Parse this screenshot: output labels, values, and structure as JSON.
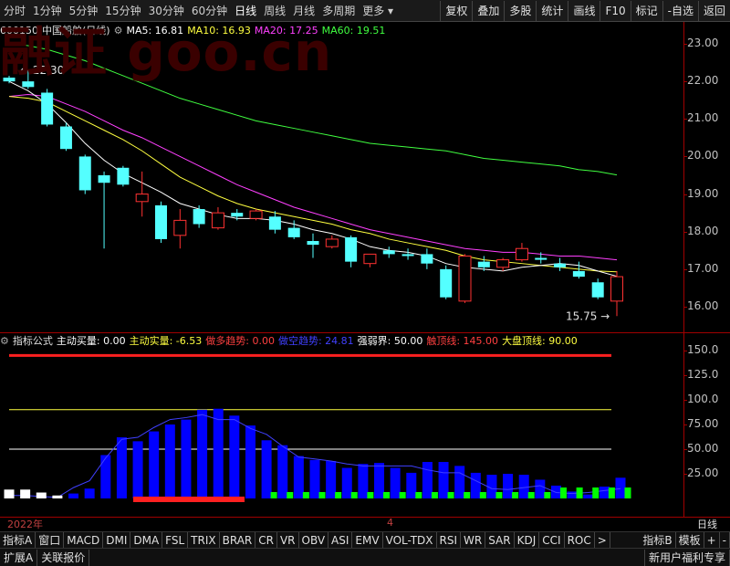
{
  "period_tabs": [
    "分时",
    "1分钟",
    "5分钟",
    "15分钟",
    "30分钟",
    "60分钟",
    "日线",
    "周线",
    "月线",
    "多周期",
    "更多"
  ],
  "active_period": "日线",
  "toolbar": [
    "复权",
    "叠加",
    "多股",
    "统计",
    "画线",
    "F10",
    "标记",
    "-自选",
    "返回"
  ],
  "watermark": "融证 goo.cn",
  "stock": {
    "code": "600150",
    "name": "中国船舶",
    "period": "(日线)"
  },
  "ma": [
    {
      "label": "MA5: 16.81",
      "color": "#ffffff"
    },
    {
      "label": "MA10: 16.93",
      "color": "#ffff40"
    },
    {
      "label": "MA20: 17.25",
      "color": "#ff40ff"
    },
    {
      "label": "MA60: 19.51",
      "color": "#40ff40"
    }
  ],
  "price_ticks": [
    "23.00",
    "22.00",
    "21.00",
    "20.00",
    "19.00",
    "18.00",
    "17.00",
    "16.00"
  ],
  "high_label": "22.30",
  "low_label": "15.75",
  "indicator_name": "指标公式",
  "indicator_values": [
    {
      "label": "主动买量: 0.00",
      "color": "#ffffff"
    },
    {
      "label": "主动实量: -6.53",
      "color": "#ffff40"
    },
    {
      "label": "做多趋势: 0.00",
      "color": "#ff4040"
    },
    {
      "label": "做空趋势: 24.81",
      "color": "#4040ff"
    },
    {
      "label": "强弱界: 50.00",
      "color": "#ffffff"
    },
    {
      "label": "触顶线: 145.00",
      "color": "#ff4040"
    },
    {
      "label": "大盘顶线: 90.00",
      "color": "#ffff40"
    }
  ],
  "ind_ticks": [
    "150.0",
    "125.0",
    "100.0",
    "75.00",
    "50.00",
    "25.00"
  ],
  "time_labels": [
    "2022年",
    "4"
  ],
  "current_period": "日线",
  "indicator_tabs": [
    "指标A",
    "窗口",
    "MACD",
    "DMI",
    "DMA",
    "FSL",
    "TRIX",
    "BRAR",
    "CR",
    "VR",
    "OBV",
    "ASI",
    "EMV",
    "VOL-TDX",
    "RSI",
    "WR",
    "SAR",
    "KDJ",
    "CCI",
    "ROC",
    ">",
    "指标B",
    "模板",
    "+",
    "-"
  ],
  "bottom_buttons": [
    "扩展A",
    "关联报价"
  ],
  "bottom_right": "新用户福利专享",
  "colors": {
    "up": "#ff3232",
    "down": "#54ffff",
    "axis": "#a00000"
  },
  "chart_data": [
    {
      "type": "candlestick",
      "title": "600150 中国船舶 (日线)",
      "ylim": [
        15.6,
        23.3
      ],
      "ohlc": [
        [
          22.1,
          22.15,
          21.95,
          22.0
        ],
        [
          22.0,
          22.3,
          21.8,
          21.85
        ],
        [
          21.7,
          21.8,
          20.8,
          20.85
        ],
        [
          20.8,
          20.9,
          20.15,
          20.2
        ],
        [
          20.0,
          20.05,
          19.0,
          19.1
        ],
        [
          19.5,
          19.6,
          17.55,
          19.3
        ],
        [
          19.7,
          19.75,
          19.2,
          19.25
        ],
        [
          18.8,
          19.6,
          18.4,
          19.0
        ],
        [
          18.7,
          18.8,
          17.7,
          17.8
        ],
        [
          17.9,
          18.6,
          17.55,
          18.3
        ],
        [
          18.6,
          18.7,
          18.1,
          18.2
        ],
        [
          18.1,
          18.65,
          18.05,
          18.5
        ],
        [
          18.5,
          18.6,
          18.3,
          18.4
        ],
        [
          18.35,
          18.6,
          18.3,
          18.55
        ],
        [
          18.4,
          18.55,
          17.95,
          18.05
        ],
        [
          18.1,
          18.3,
          17.8,
          17.85
        ],
        [
          17.75,
          17.95,
          17.3,
          17.65
        ],
        [
          17.6,
          17.9,
          17.55,
          17.8
        ],
        [
          17.85,
          17.9,
          17.05,
          17.2
        ],
        [
          17.15,
          17.4,
          17.05,
          17.4
        ],
        [
          17.5,
          17.6,
          17.3,
          17.4
        ],
        [
          17.4,
          17.55,
          17.25,
          17.35
        ],
        [
          17.4,
          17.55,
          17.0,
          17.15
        ],
        [
          17.0,
          17.1,
          16.2,
          16.25
        ],
        [
          16.15,
          17.4,
          16.1,
          17.35
        ],
        [
          17.2,
          17.35,
          16.95,
          17.05
        ],
        [
          17.05,
          17.3,
          16.95,
          17.25
        ],
        [
          17.25,
          17.7,
          17.2,
          17.55
        ],
        [
          17.3,
          17.45,
          17.15,
          17.25
        ],
        [
          17.15,
          17.3,
          16.95,
          17.05
        ],
        [
          16.95,
          17.2,
          16.75,
          16.8
        ],
        [
          16.65,
          16.75,
          16.2,
          16.25
        ],
        [
          16.15,
          16.95,
          15.75,
          16.8
        ]
      ],
      "ma5": [
        22.0,
        21.75,
        21.4,
        20.9,
        20.35,
        19.9,
        19.55,
        19.3,
        19.05,
        18.75,
        18.6,
        18.45,
        18.35,
        18.35,
        18.3,
        18.2,
        18.05,
        17.95,
        17.8,
        17.6,
        17.5,
        17.45,
        17.35,
        17.15,
        17.05,
        17.0,
        16.95,
        17.05,
        17.1,
        17.15,
        17.1,
        16.95,
        16.81
      ],
      "ma10": [
        21.6,
        21.55,
        21.45,
        21.2,
        20.95,
        20.7,
        20.45,
        20.15,
        19.8,
        19.45,
        19.2,
        18.95,
        18.75,
        18.6,
        18.5,
        18.4,
        18.3,
        18.2,
        18.05,
        17.95,
        17.8,
        17.7,
        17.6,
        17.5,
        17.35,
        17.25,
        17.2,
        17.15,
        17.1,
        17.05,
        17.0,
        16.95,
        16.93
      ],
      "ma20": [
        21.6,
        21.65,
        21.6,
        21.4,
        21.2,
        20.95,
        20.7,
        20.5,
        20.25,
        20.0,
        19.75,
        19.5,
        19.25,
        19.05,
        18.85,
        18.65,
        18.5,
        18.35,
        18.2,
        18.05,
        17.95,
        17.85,
        17.75,
        17.65,
        17.55,
        17.5,
        17.45,
        17.45,
        17.4,
        17.35,
        17.35,
        17.3,
        17.25
      ],
      "ma60": [
        23.0,
        22.95,
        22.85,
        22.7,
        22.55,
        22.35,
        22.15,
        21.95,
        21.75,
        21.55,
        21.4,
        21.25,
        21.1,
        20.95,
        20.85,
        20.75,
        20.65,
        20.55,
        20.45,
        20.35,
        20.3,
        20.25,
        20.2,
        20.15,
        20.05,
        19.95,
        19.9,
        19.85,
        19.8,
        19.75,
        19.65,
        19.6,
        19.51
      ]
    },
    {
      "type": "bar",
      "title": "指标公式",
      "ylim": [
        0,
        160
      ],
      "series": [
        {
          "name": "主动实量",
          "values": [
            3,
            3,
            2,
            1,
            11,
            18,
            41,
            60,
            62,
            72,
            80,
            82,
            85,
            80,
            80,
            71,
            65,
            53,
            42,
            40,
            38,
            35,
            33,
            33,
            33,
            33,
            29,
            26,
            26,
            18,
            10,
            9,
            11,
            13,
            6,
            5,
            6,
            8,
            10
          ]
        },
        {
          "name": "做空趋势",
          "values": [
            0,
            0,
            0,
            0,
            5,
            10,
            44,
            62,
            58,
            68,
            75,
            80,
            90,
            91,
            84,
            74,
            59,
            54,
            43,
            39,
            38,
            31,
            35,
            36,
            31,
            26,
            37,
            37,
            33,
            26,
            24,
            25,
            24,
            19,
            13,
            7,
            4,
            12,
            21
          ]
        },
        {
          "name": "主动买量",
          "values": [
            3,
            3,
            2,
            1,
            0,
            0,
            0,
            0,
            0,
            0,
            0,
            0,
            0,
            0,
            0,
            0,
            0,
            0,
            0,
            0,
            0,
            0,
            0,
            0,
            0,
            0,
            0,
            0,
            0,
            0,
            0,
            0,
            0,
            0,
            0,
            0,
            0,
            0,
            0
          ]
        }
      ],
      "lines": {
        "强弱界": 50,
        "大盘顶线": 90,
        "触顶线": 145
      }
    }
  ]
}
